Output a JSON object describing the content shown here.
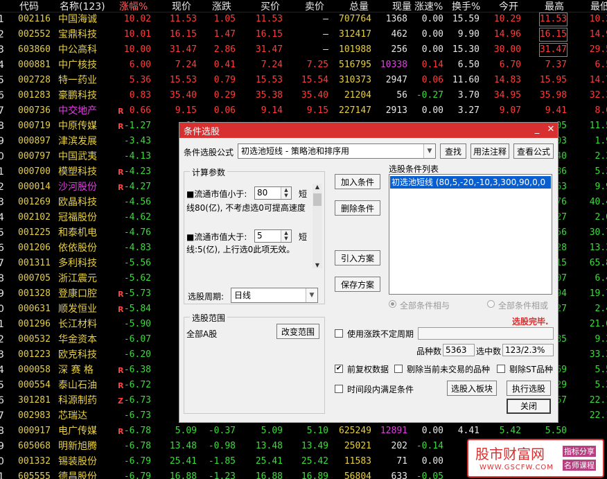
{
  "table": {
    "headers": [
      "代码",
      "名称(123)",
      "涨幅%",
      "现价",
      "涨跌",
      "买价",
      "卖价",
      "总量",
      "现量",
      "涨速%",
      "换手%",
      "今开",
      "最高",
      "最低"
    ],
    "rows": [
      {
        "idx": "1",
        "code": "002116",
        "name": "中国海诚",
        "flag": "",
        "chg_pct": "10.02",
        "price": "11.53",
        "chg": "1.05",
        "bid": "11.53",
        "ask": "–",
        "vol": "707764",
        "cur": "1368",
        "speed": "0.00",
        "turn": "15.59",
        "open": "10.29",
        "high": "11.53",
        "low": "10.2"
      },
      {
        "idx": "2",
        "code": "002552",
        "name": "宝鼎科技",
        "flag": "",
        "chg_pct": "10.01",
        "price": "16.15",
        "chg": "1.47",
        "bid": "16.15",
        "ask": "–",
        "vol": "312417",
        "cur": "462",
        "speed": "0.00",
        "turn": "9.90",
        "open": "14.96",
        "high": "16.15",
        "low": "14.9"
      },
      {
        "idx": "3",
        "code": "603860",
        "name": "中公高科",
        "flag": "",
        "chg_pct": "10.00",
        "price": "31.47",
        "chg": "2.86",
        "bid": "31.47",
        "ask": "–",
        "vol": "101988",
        "cur": "256",
        "speed": "0.00",
        "turn": "15.30",
        "open": "30.00",
        "high": "31.47",
        "low": "29.5"
      },
      {
        "idx": "4",
        "code": "000881",
        "name": "中广核技",
        "flag": "",
        "chg_pct": "6.00",
        "price": "7.24",
        "chg": "0.41",
        "bid": "7.24",
        "ask": "7.25",
        "vol": "516795",
        "cur": "10338",
        "speed": "0.14",
        "turn": "6.50",
        "open": "6.70",
        "high": "7.37",
        "low": "6.5"
      },
      {
        "idx": "5",
        "code": "002728",
        "name": "特一药业",
        "flag": "",
        "chg_pct": "5.36",
        "price": "15.53",
        "chg": "0.79",
        "bid": "15.53",
        "ask": "15.54",
        "vol": "310373",
        "cur": "2947",
        "speed": "0.06",
        "turn": "11.60",
        "open": "14.83",
        "high": "15.95",
        "low": "14.7"
      },
      {
        "idx": "6",
        "code": "001283",
        "name": "豪鹏科技",
        "flag": "",
        "chg_pct": "0.83",
        "price": "35.40",
        "chg": "0.29",
        "bid": "35.38",
        "ask": "35.40",
        "vol": "21204",
        "cur": "56",
        "speed": "-0.27",
        "turn": "3.70",
        "open": "34.95",
        "high": "35.98",
        "low": "32.3"
      },
      {
        "idx": "7",
        "code": "000736",
        "name": "中交地产",
        "flag": "R",
        "chg_pct": "0.66",
        "price": "9.15",
        "chg": "0.06",
        "bid": "9.14",
        "ask": "9.15",
        "vol": "227147",
        "cur": "2913",
        "speed": "0.00",
        "turn": "3.27",
        "open": "9.07",
        "high": "9.41",
        "low": "8.6"
      },
      {
        "idx": "8",
        "code": "000719",
        "name": "中原传媒",
        "flag": "R",
        "chg_pct": "-1.27",
        "price": "11",
        "chg": "",
        "bid": "",
        "ask": "",
        "vol": "",
        "cur": "",
        "speed": "",
        "turn": "",
        "open": "",
        "high": "05",
        "low": "11.5"
      },
      {
        "idx": "9",
        "code": "000897",
        "name": "津滨发展",
        "flag": "",
        "chg_pct": "-3.43",
        "price": "1",
        "chg": "",
        "bid": "",
        "ask": "",
        "vol": "",
        "cur": "",
        "speed": "",
        "turn": "",
        "open": "",
        "high": "03",
        "low": "1.9"
      },
      {
        "idx": "0",
        "code": "000797",
        "name": "中国武夷",
        "flag": "",
        "chg_pct": "-4.13",
        "price": "2",
        "chg": "",
        "bid": "",
        "ask": "",
        "vol": "",
        "cur": "",
        "speed": "",
        "turn": "",
        "open": "",
        "high": "40",
        "low": "2.3"
      },
      {
        "idx": "1",
        "code": "000700",
        "name": "模塑科技",
        "flag": "R",
        "chg_pct": "-4.23",
        "price": "5",
        "chg": "",
        "bid": "",
        "ask": "",
        "vol": "",
        "cur": "",
        "speed": "",
        "turn": "",
        "open": "",
        "high": "86",
        "low": "5.3"
      },
      {
        "idx": "2",
        "code": "000014",
        "name": "沙河股份",
        "flag": "R",
        "chg_pct": "-4.27",
        "price": "10",
        "chg": "",
        "bid": "",
        "ask": "",
        "vol": "",
        "cur": "",
        "speed": "",
        "turn": "",
        "open": "",
        "high": "63",
        "low": "9.9"
      },
      {
        "idx": "3",
        "code": "001269",
        "name": "欧晶科技",
        "flag": "",
        "chg_pct": "-4.56",
        "price": "40",
        "chg": "",
        "bid": "",
        "ask": "",
        "vol": "",
        "cur": "",
        "speed": "",
        "turn": "",
        "open": "",
        "high": "76",
        "low": "40.4"
      },
      {
        "idx": "4",
        "code": "002102",
        "name": "冠福股份",
        "flag": "",
        "chg_pct": "-4.62",
        "price": "2",
        "chg": "",
        "bid": "",
        "ask": "",
        "vol": "",
        "cur": "",
        "speed": "",
        "turn": "",
        "open": "",
        "high": "27",
        "low": "2.0"
      },
      {
        "idx": "5",
        "code": "001225",
        "name": "和泰机电",
        "flag": "",
        "chg_pct": "-4.76",
        "price": "30",
        "chg": "",
        "bid": "",
        "ask": "",
        "vol": "",
        "cur": "",
        "speed": "",
        "turn": "",
        "open": "",
        "high": "56",
        "low": "30.7"
      },
      {
        "idx": "6",
        "code": "001206",
        "name": "依依股份",
        "flag": "",
        "chg_pct": "-4.83",
        "price": "11",
        "chg": "",
        "bid": "",
        "ask": "",
        "vol": "",
        "cur": "",
        "speed": "",
        "turn": "",
        "open": "",
        "high": "28",
        "low": "13.3"
      },
      {
        "idx": "7",
        "code": "001311",
        "name": "多利科技",
        "flag": "",
        "chg_pct": "-5.56",
        "price": "32",
        "chg": "",
        "bid": "",
        "ask": "",
        "vol": "",
        "cur": "",
        "speed": "",
        "turn": "",
        "open": "",
        "high": "15",
        "low": "65.8"
      },
      {
        "idx": "8",
        "code": "000705",
        "name": "浙江震元",
        "flag": "",
        "chg_pct": "-5.62",
        "price": "6",
        "chg": "",
        "bid": "",
        "ask": "",
        "vol": "",
        "cur": "",
        "speed": "",
        "turn": "",
        "open": "",
        "high": "07",
        "low": "6.4"
      },
      {
        "idx": "9",
        "code": "001328",
        "name": "登康口腔",
        "flag": "R",
        "chg_pct": "-5.73",
        "price": "19",
        "chg": "",
        "bid": "",
        "ask": "",
        "vol": "",
        "cur": "",
        "speed": "",
        "turn": "",
        "open": "",
        "high": "94",
        "low": "19.7"
      },
      {
        "idx": "0",
        "code": "000631",
        "name": "顺发恒业",
        "flag": "R",
        "chg_pct": "-5.84",
        "price": "2",
        "chg": "",
        "bid": "",
        "ask": "",
        "vol": "",
        "cur": "",
        "speed": "",
        "turn": "",
        "open": "",
        "high": "27",
        "low": "2.4"
      },
      {
        "idx": "1",
        "code": "001296",
        "name": "长江材料",
        "flag": "",
        "chg_pct": "-5.90",
        "price": "20",
        "chg": "",
        "bid": "",
        "ask": "",
        "vol": "",
        "cur": "",
        "speed": "",
        "turn": "",
        "open": "",
        "high": "",
        "low": "21.6"
      },
      {
        "idx": "2",
        "code": "000532",
        "name": "华金资本",
        "flag": "",
        "chg_pct": "-6.07",
        "price": "9",
        "chg": "",
        "bid": "",
        "ask": "",
        "vol": "",
        "cur": "",
        "speed": "",
        "turn": "",
        "open": "",
        "high": "85",
        "low": "9.3"
      },
      {
        "idx": "3",
        "code": "001223",
        "name": "欧克科技",
        "flag": "",
        "chg_pct": "-6.20",
        "price": "34",
        "chg": "",
        "bid": "",
        "ask": "",
        "vol": "",
        "cur": "",
        "speed": "",
        "turn": "",
        "open": "",
        "high": "",
        "low": "33.3"
      },
      {
        "idx": "4",
        "code": "000058",
        "name": "深 赛 格",
        "flag": "R",
        "chg_pct": "-6.38",
        "price": "5",
        "chg": "",
        "bid": "",
        "ask": "",
        "vol": "",
        "cur": "",
        "speed": "",
        "turn": "",
        "open": "",
        "high": "69",
        "low": "5.5"
      },
      {
        "idx": "5",
        "code": "000554",
        "name": "泰山石油",
        "flag": "R",
        "chg_pct": "-6.72",
        "price": "5",
        "chg": "",
        "bid": "",
        "ask": "",
        "vol": "",
        "cur": "",
        "speed": "",
        "turn": "",
        "open": "",
        "high": "29",
        "low": "5.3"
      },
      {
        "idx": "6",
        "code": "301281",
        "name": "科源制药",
        "flag": "Z",
        "chg_pct": "-6.73",
        "price": "22",
        "chg": "",
        "bid": "",
        "ask": "",
        "vol": "",
        "cur": "",
        "speed": "",
        "turn": "",
        "open": "",
        "high": "67",
        "low": "22.1"
      },
      {
        "idx": "7",
        "code": "002983",
        "name": "芯瑞达",
        "flag": "",
        "chg_pct": "-6.73",
        "price": "20",
        "chg": "",
        "bid": "",
        "ask": "",
        "vol": "",
        "cur": "",
        "speed": "",
        "turn": "",
        "open": "",
        "high": "",
        "low": "22.1"
      },
      {
        "idx": "8",
        "code": "000917",
        "name": "电广传媒",
        "flag": "R",
        "chg_pct": "-6.78",
        "price": "5.09",
        "chg": "-0.37",
        "bid": "5.09",
        "ask": "5.10",
        "vol": "625249",
        "cur": "12891",
        "speed": "0.00",
        "turn": "4.41",
        "open": "5.42",
        "high": "5.50",
        "low": ""
      },
      {
        "idx": "9",
        "code": "605068",
        "name": "明新旭腾",
        "flag": "",
        "chg_pct": "-6.78",
        "price": "13.48",
        "chg": "-0.98",
        "bid": "13.48",
        "ask": "13.49",
        "vol": "25021",
        "cur": "202",
        "speed": "-0.14",
        "turn": "",
        "open": "",
        "high": "",
        "low": ""
      },
      {
        "idx": "0",
        "code": "001332",
        "name": "锡装股份",
        "flag": "",
        "chg_pct": "-6.79",
        "price": "25.41",
        "chg": "-1.85",
        "bid": "25.41",
        "ask": "25.42",
        "vol": "11583",
        "cur": "71",
        "speed": "0.00",
        "turn": "",
        "open": "",
        "high": "",
        "low": ""
      },
      {
        "idx": "1",
        "code": "605555",
        "name": "德昌股份",
        "flag": "",
        "chg_pct": "-6.79",
        "price": "16.88",
        "chg": "-1.23",
        "bid": "16.88",
        "ask": "16.89",
        "vol": "56804",
        "cur": "633",
        "speed": "-0.05",
        "turn": "",
        "open": "",
        "high": "",
        "low": ""
      }
    ]
  },
  "dialog": {
    "title": "条件选股",
    "formula_label": "条件选股公式",
    "formula_value": "初选池短线  - 策略池和排序用",
    "btn_find": "查找",
    "btn_usage": "用法注释",
    "btn_view": "查看公式",
    "params_title": "计算参数",
    "param1_prefix": "■流通市值小于:",
    "param1_value": "80",
    "param1_suffix": "短",
    "param1_desc": "线80(亿), 不考虑选0可提高速度",
    "param2_prefix": "■流通市值大于:",
    "param2_value": "5",
    "param2_suffix": "短",
    "param2_desc": "线:5(亿), 上行选0此项无效。",
    "period_label": "选股周期:",
    "period_value": "日线",
    "btn_add": "加入条件",
    "btn_delete": "删除条件",
    "btn_import": "引入方案",
    "btn_save": "保存方案",
    "list_title": "选股条件列表",
    "list_item": "初选池短线 (80,5,-20,-10,3,300,90,0,0",
    "radio_and": "全部条件相与",
    "radio_or": "全部条件相或",
    "range_title": "选股范围",
    "range_value": "全部A股",
    "btn_change_range": "改变范围",
    "status": "选股完毕.",
    "chk_uncertain": "使用涨跌不定周期",
    "count_label": "品种数",
    "count_value": "5363",
    "selected_label": "选中数",
    "selected_value": "123/2.3%",
    "chk_fq": "前复权数据",
    "chk_remove_untraded": "剔除当前未交易的品种",
    "chk_remove_st": "剔除ST品种",
    "chk_period": "时间段内满足条件",
    "btn_to_block": "选股入板块",
    "btn_execute": "执行选股",
    "btn_close": "关闭"
  },
  "watermark": {
    "name": "股市财富网",
    "url": "WWW.GSCFW.COM",
    "tag1": "指标分享",
    "tag2": "名师课程"
  },
  "colors": {
    "up": "#ff3c3c",
    "down": "#3cdc3c",
    "yellow": "#e8d040",
    "code": "#e8d040",
    "magenta": "#e040e0",
    "title_bar": "#d83030"
  }
}
